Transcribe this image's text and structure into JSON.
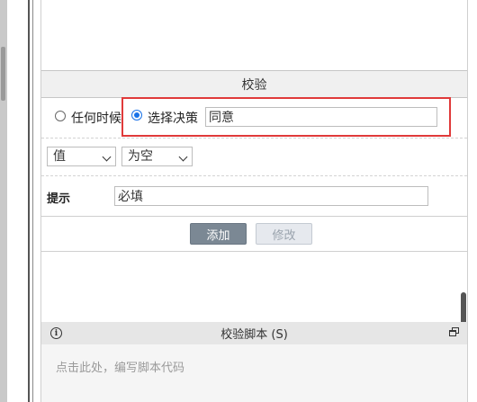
{
  "section": {
    "title": "校验"
  },
  "validation": {
    "radio_any_label": "任何时候",
    "radio_decision_label": "选择决策",
    "decision_value": "同意",
    "select_value": "值",
    "select_condition": "为空",
    "hint_label": "提示",
    "hint_value": "必填",
    "add_button": "添加",
    "edit_button": "修改"
  },
  "script": {
    "title": "校验脚本 (S)",
    "placeholder": "点击此处，编写脚本代码"
  },
  "icons": {
    "info": "info-icon",
    "restore": "restore-window-icon",
    "chevron": "chevron-down-icon"
  },
  "colors": {
    "highlight": "#e03a3a",
    "radio_selected": "#1a73e8",
    "primary_button": "#7b8894"
  }
}
